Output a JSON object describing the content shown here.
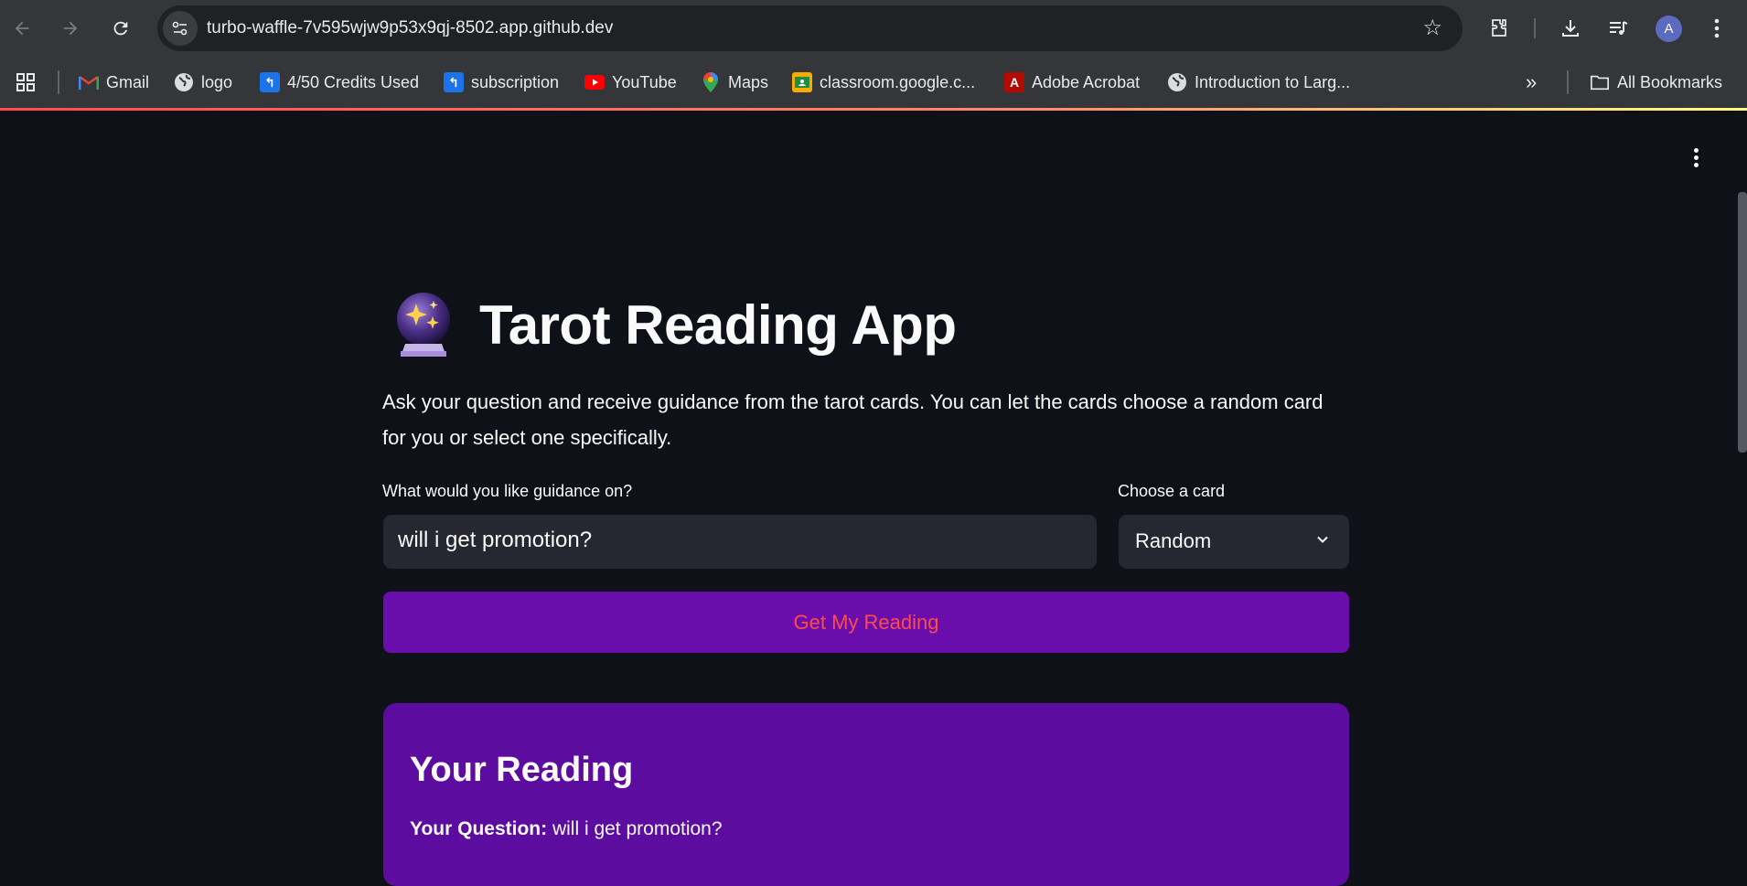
{
  "browser": {
    "url": "turbo-waffle-7v595wjw9p53x9qj-8502.app.github.dev",
    "profile_initial": "A",
    "bookmarks": [
      {
        "label": "Gmail",
        "icon": "gmail-icon"
      },
      {
        "label": "logo",
        "icon": "globe-icon"
      },
      {
        "label": "4/50 Credits Used",
        "icon": "bookmark-app-icon"
      },
      {
        "label": "subscription",
        "icon": "bookmark-app-icon"
      },
      {
        "label": "YouTube",
        "icon": "youtube-icon"
      },
      {
        "label": "Maps",
        "icon": "maps-icon"
      },
      {
        "label": "classroom.google.c...",
        "icon": "classroom-icon"
      },
      {
        "label": "Adobe Acrobat",
        "icon": "acrobat-icon"
      },
      {
        "label": "Introduction to Larg...",
        "icon": "globe-icon"
      }
    ],
    "overflow_label": "»",
    "all_bookmarks_label": "All Bookmarks"
  },
  "app": {
    "title": "Tarot Reading App",
    "description": "Ask your question and receive guidance from the tarot cards. You can let the cards choose a random card for you or select one specifically.",
    "question_label": "What would you like guidance on?",
    "question_value": "will i get promotion?",
    "card_label": "Choose a card",
    "card_selected": "Random",
    "button_label": "Get My Reading",
    "reading": {
      "heading": "Your Reading",
      "question_prefix": "Your Question:",
      "question_text": "will i get promotion?"
    }
  },
  "colors": {
    "background": "#0e1117",
    "button": "#6a0dad",
    "button_text": "#ff4b4b",
    "reading_card": "#5c0da0",
    "input_bg": "#262730"
  }
}
